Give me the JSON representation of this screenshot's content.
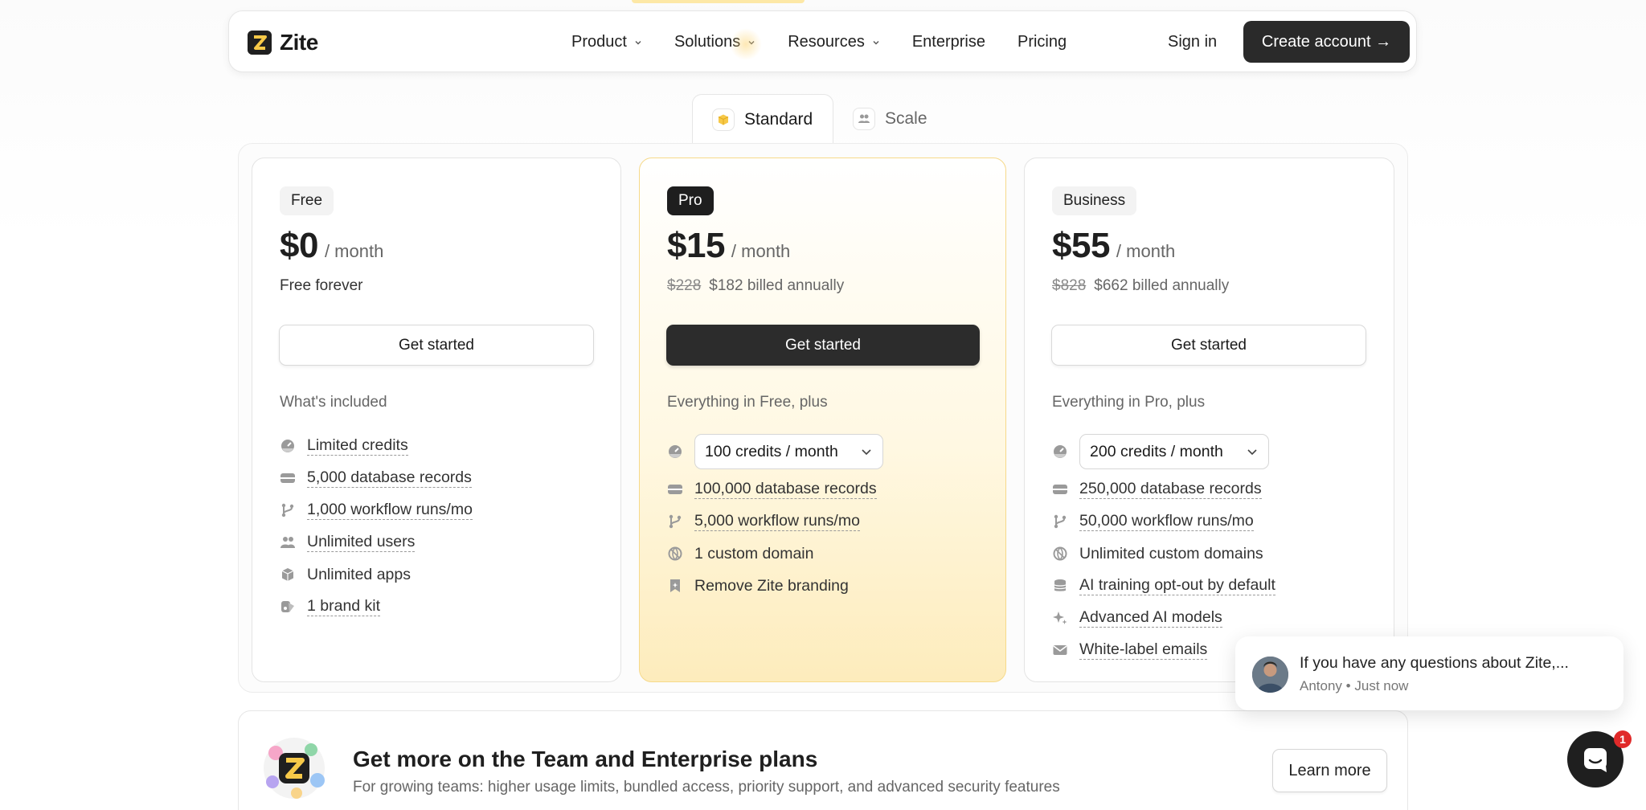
{
  "nav": {
    "logo_text": "Zite",
    "links": [
      {
        "label": "Product",
        "has_dropdown": true
      },
      {
        "label": "Solutions",
        "has_dropdown": true
      },
      {
        "label": "Resources",
        "has_dropdown": true
      },
      {
        "label": "Enterprise",
        "has_dropdown": false
      },
      {
        "label": "Pricing",
        "has_dropdown": false
      }
    ],
    "sign_in": "Sign in",
    "create_account": "Create account →"
  },
  "tabs": [
    {
      "label": "Standard",
      "active": true,
      "icon": "cube-icon"
    },
    {
      "label": "Scale",
      "active": false,
      "icon": "users-icon"
    }
  ],
  "plans": {
    "free": {
      "badge": "Free",
      "price": "$0",
      "period": "/ month",
      "subtitle": "Free forever",
      "cta": "Get started",
      "included_title": "What's included",
      "features": [
        {
          "icon": "gauge-icon",
          "text": "Limited credits",
          "underlined": true
        },
        {
          "icon": "database-icon",
          "text": "5,000 database records",
          "underlined": true
        },
        {
          "icon": "git-branch-icon",
          "text": "1,000 workflow runs/mo",
          "underlined": true
        },
        {
          "icon": "users-icon",
          "text": "Unlimited users",
          "underlined": true
        },
        {
          "icon": "cube-icon",
          "text": "Unlimited apps",
          "underlined": false
        },
        {
          "icon": "brand-icon",
          "text": "1 brand kit",
          "underlined": true
        }
      ]
    },
    "pro": {
      "badge": "Pro",
      "price": "$15",
      "period": "/ month",
      "old_price": "$228",
      "billed": "$182 billed annually",
      "cta": "Get started",
      "included_title": "Everything in Free, plus",
      "credits_select": "100 credits / month",
      "features": [
        {
          "icon": "database-icon",
          "text": "100,000 database records",
          "underlined": true
        },
        {
          "icon": "git-branch-icon",
          "text": "5,000 workflow runs/mo",
          "underlined": true
        },
        {
          "icon": "globe-off-icon",
          "text": "1 custom domain",
          "underlined": false
        },
        {
          "icon": "bookmark-icon",
          "text": "Remove Zite branding",
          "underlined": false
        }
      ]
    },
    "business": {
      "badge": "Business",
      "price": "$55",
      "period": "/ month",
      "old_price": "$828",
      "billed": "$662 billed annually",
      "cta": "Get started",
      "included_title": "Everything in Pro, plus",
      "credits_select": "200 credits / month",
      "features": [
        {
          "icon": "database-icon",
          "text": "250,000 database records",
          "underlined": true
        },
        {
          "icon": "git-branch-icon",
          "text": "50,000 workflow runs/mo",
          "underlined": true
        },
        {
          "icon": "globe-off-icon",
          "text": "Unlimited custom domains",
          "underlined": false
        },
        {
          "icon": "stack-icon",
          "text": "AI training opt-out by default",
          "underlined": true
        },
        {
          "icon": "sparkle-icon",
          "text": "Advanced AI models",
          "underlined": true
        },
        {
          "icon": "mail-icon",
          "text": "White-label emails",
          "underlined": true
        }
      ]
    }
  },
  "chat": {
    "message": "If you have any questions about Zite,...",
    "author": "Antony",
    "time": "Just now"
  },
  "enterprise": {
    "title": "Get more on the Team and Enterprise plans",
    "subtitle": "For growing teams: higher usage limits, bundled access, priority support, and advanced security features",
    "cta": "Learn more"
  },
  "launcher": {
    "badge_count": "1"
  },
  "colors": {
    "accent_yellow": "#f7c948",
    "dark": "#2a2a2a",
    "notification_red": "#e02a2a"
  }
}
